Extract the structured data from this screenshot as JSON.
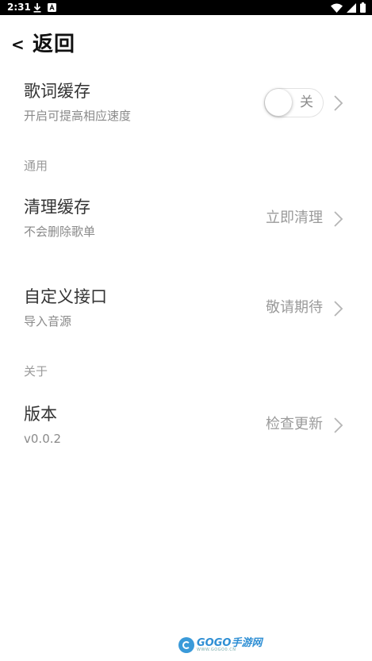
{
  "status_bar": {
    "time": "2:31",
    "left_icons": [
      "download-icon",
      "notification-a-icon"
    ],
    "right_icons": [
      "wifi-icon",
      "signal-icon",
      "battery-icon"
    ]
  },
  "header": {
    "back_chevron": "<",
    "back_label": "返回"
  },
  "lyrics_cache": {
    "title": "歌词缓存",
    "subtitle": "开启可提高相应速度",
    "toggle_label": "关",
    "toggle_on": false
  },
  "sections": {
    "general": "通用",
    "about": "关于"
  },
  "clear_cache": {
    "title": "清理缓存",
    "subtitle": "不会删除歌单",
    "action": "立即清理"
  },
  "custom_api": {
    "title": "自定义接口",
    "subtitle": "导入音源",
    "action": "敬请期待"
  },
  "version": {
    "title": "版本",
    "subtitle": "v0.0.2",
    "action": "检查更新"
  },
  "watermark": {
    "brand": "GOGO手游网",
    "url": "WWW.GOGO0.CN"
  },
  "colors": {
    "text_primary": "#333333",
    "text_secondary": "#8a8a8a",
    "chevron": "#b5b5b5",
    "status_bar": "#000000",
    "watermark_blue": "#2f8fd4"
  }
}
